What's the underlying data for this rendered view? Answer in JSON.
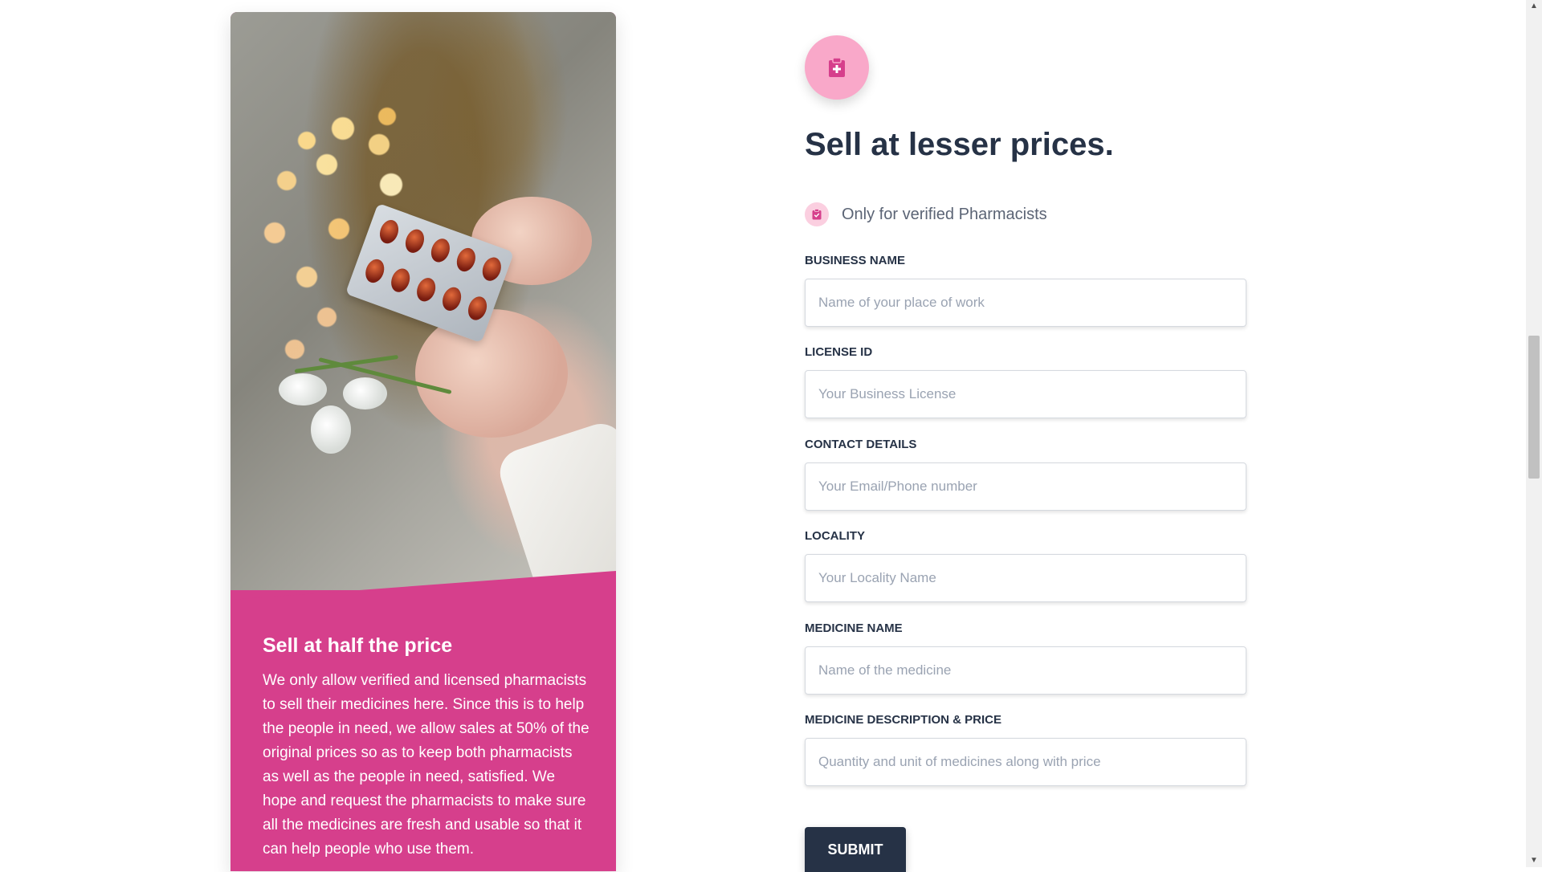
{
  "promo_card": {
    "image_alt": "Hands holding a blister pack of pills with flowers",
    "title": "Sell at half the price",
    "text": "We only allow verified and licensed pharmacists to sell their medicines here. Since this is to help the people in need, we allow sales at 50% of the original prices so as to keep both pharmacists as well as the people in need, satisfied. We hope and request the pharmacists to make sure all the medicines are fresh and usable so that it can help people who use them."
  },
  "form": {
    "icon": "clipboard-medical-icon",
    "heading": "Sell at lesser prices.",
    "verified_note": "Only for verified Pharmacists",
    "verified_icon": "clipboard-check-icon",
    "fields": [
      {
        "label": "BUSINESS NAME",
        "placeholder": "Name of your place of work",
        "value": ""
      },
      {
        "label": "LICENSE ID",
        "placeholder": "Your Business License",
        "value": ""
      },
      {
        "label": "CONTACT DETAILS",
        "placeholder": "Your Email/Phone number",
        "value": ""
      },
      {
        "label": "LOCALITY",
        "placeholder": "Your Locality Name",
        "value": ""
      },
      {
        "label": "MEDICINE NAME",
        "placeholder": "Name of the medicine",
        "value": ""
      },
      {
        "label": "MEDICINE DESCRIPTION & PRICE",
        "placeholder": "Quantity and unit of medicines along with price",
        "value": ""
      }
    ],
    "submit_label": "SUBMIT"
  },
  "colors": {
    "accent_pink": "#d63f8c",
    "icon_circle": "#f9a8c9",
    "dark_navy": "#263246"
  }
}
